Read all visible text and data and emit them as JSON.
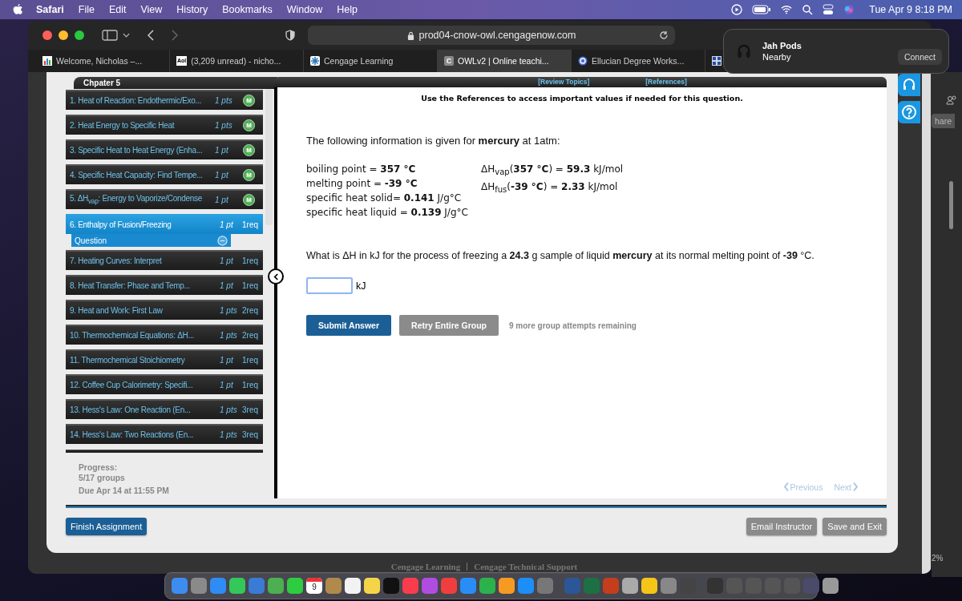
{
  "menubar": {
    "app": "Safari",
    "menus": [
      "File",
      "Edit",
      "View",
      "History",
      "Bookmarks",
      "Window",
      "Help"
    ],
    "clock": "Tue Apr 9  8:18 PM"
  },
  "browser": {
    "address": "prod04-cnow-owl.cengagenow.com",
    "tabs": [
      {
        "title": "Welcome, Nicholas –...",
        "selected": false
      },
      {
        "title": "(3,209 unread) - nicho...",
        "icon_text": "Aol",
        "selected": false
      },
      {
        "title": "Cengage Learning",
        "selected": false
      },
      {
        "title": "OWLv2 | Online teachi...",
        "icon_text": "C",
        "selected": true
      },
      {
        "title": "Ellucian Degree Works...",
        "selected": false
      },
      {
        "selected": false
      }
    ]
  },
  "notification": {
    "title": "Jah Pods",
    "subtitle": "Nearby",
    "button": "Connect"
  },
  "assignment": {
    "chapter": "Chpater 5",
    "items": [
      {
        "label": "1. Heat of Reaction: Endothermic/Exo...",
        "points": "1 pts",
        "kind": "mastered",
        "badge": "M",
        "selected": false
      },
      {
        "label": "2. Heat Energy to Specific Heat",
        "points": "1 pts",
        "kind": "mastered",
        "badge": "M",
        "selected": false
      },
      {
        "label": "3. Specific Heat to Heat Energy (Enha...",
        "points": "1 pt",
        "kind": "mastered",
        "badge": "M",
        "selected": false
      },
      {
        "label": "4. Specific Heat Capacity: Find Tempe...",
        "points": "1 pt",
        "kind": "mastered",
        "badge": "M",
        "selected": false
      },
      {
        "label": "5. ΔH$_{vap}$: Energy to Vaporize/Condense",
        "points": "1 pt",
        "kind": "mastered",
        "badge": "M",
        "selected": false
      },
      {
        "label": "6. Enthalpy of Fusion/Freezing",
        "points": "1 pt",
        "kind": "req",
        "requirement": "1req",
        "selected": true,
        "children": [
          {
            "label": "Question"
          }
        ]
      },
      {
        "label": "7. Heating Curves: Interpret",
        "points": "1 pt",
        "kind": "req",
        "requirement": "1req",
        "selected": false
      },
      {
        "label": "8. Heat Transfer: Phase and Temp...",
        "points": "1 pt",
        "kind": "req",
        "requirement": "1req",
        "selected": false
      },
      {
        "label": "9. Heat and Work: First Law",
        "points": "1 pts",
        "kind": "req",
        "requirement": "2req",
        "selected": false
      },
      {
        "label": "10. Thermochemical Equations: ΔH...",
        "points": "1 pts",
        "kind": "req",
        "requirement": "2req",
        "selected": false
      },
      {
        "label": "11. Thermochemical Stoichiometry",
        "points": "1 pt",
        "kind": "req",
        "requirement": "1req",
        "selected": false
      },
      {
        "label": "12. Coffee Cup Calorimetry: Specifi...",
        "points": "1 pt",
        "kind": "req",
        "requirement": "1req",
        "selected": false
      },
      {
        "label": "13. Hess's Law: One Reaction (En...",
        "points": "1 pts",
        "kind": "req",
        "requirement": "3req",
        "selected": false
      },
      {
        "label": "14. Hess's Law: Two Reactions (En...",
        "points": "1 pts",
        "kind": "req",
        "requirement": "3req",
        "selected": false
      }
    ],
    "progress": {
      "label": "Progress:",
      "groups": "5/17 groups",
      "due": "Due Apr 14 at 11:55 PM"
    }
  },
  "question": {
    "links": [
      "[Review Topics]",
      "[References]"
    ],
    "instruction": "Use the References to access important values if needed for this question.",
    "intro": "The following information is given for **mercury** at 1atm:",
    "facts_left": [
      "boiling point = **357 °C**",
      "melting point = **-39 °C**",
      "specific heat solid= **0.141** J/g°C",
      "specific heat liquid = **0.139** J/g°C"
    ],
    "facts_right": [
      "ΔH$_{vap}$(**357 °C**) = **59.3** kJ/mol",
      "ΔH$_{fus}$(**-39 °C**) = **2.33** kJ/mol"
    ],
    "prompt": "What is ΔH in kJ for the process of freezing a **24.3** g sample of liquid **mercury** at its normal melting point of **-39** °C.",
    "answer": {
      "unit": "kJ"
    },
    "buttons": [
      {
        "label": "Submit Answer",
        "kind": "primary"
      },
      {
        "label": "Retry Entire Group",
        "kind": "secondary"
      }
    ],
    "attempts": "9 more group attempts remaining",
    "nav": [
      {
        "label": "Previous",
        "disabled": true
      },
      {
        "label": "Next",
        "disabled": true
      }
    ]
  },
  "footer_buttons": [
    {
      "label": "Finish Assignment",
      "kind": "primary"
    },
    {
      "label": "Email Instructor",
      "kind": "secondary"
    },
    {
      "label": "Save and Exit",
      "kind": "secondary"
    }
  ],
  "page_footer": [
    "Cengage Learning",
    "Cengage Technical Support"
  ],
  "side_window": {
    "button": "hare",
    "reading": "2%"
  },
  "dock": {
    "calendar_day": "9"
  }
}
